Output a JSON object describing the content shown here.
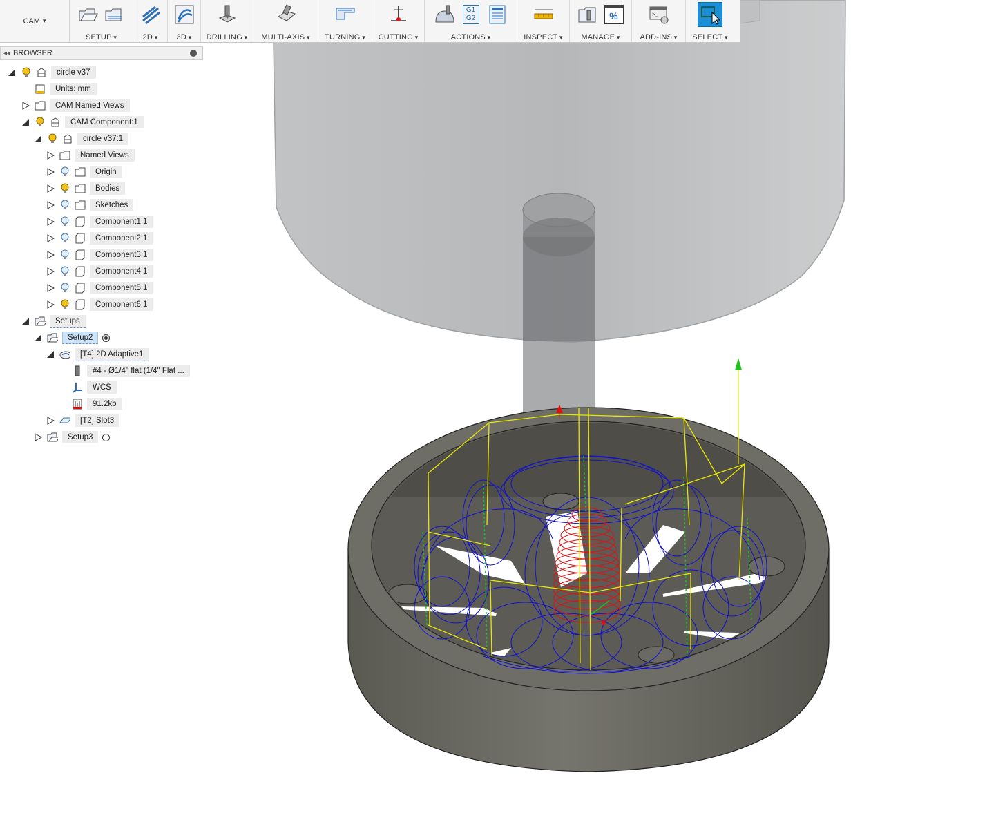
{
  "toolbar": {
    "workspace": "CAM",
    "groups": [
      {
        "label": "SETUP"
      },
      {
        "label": "2D"
      },
      {
        "label": "3D"
      },
      {
        "label": "DRILLING"
      },
      {
        "label": "MULTI-AXIS"
      },
      {
        "label": "TURNING"
      },
      {
        "label": "CUTTING"
      },
      {
        "label": "ACTIONS"
      },
      {
        "label": "INSPECT"
      },
      {
        "label": "MANAGE"
      },
      {
        "label": "ADD-INS"
      },
      {
        "label": "SELECT"
      }
    ],
    "icon_text": {
      "g1g2_top": "G1",
      "g1g2_bottom": "G2",
      "percent": "%"
    },
    "colors": {
      "select_active": "#1a8fd6",
      "accent_blue": "#2c6fb8"
    }
  },
  "browser": {
    "title": "BROWSER",
    "root": "circle v37",
    "units": "Units: mm",
    "cam_named_views": "CAM Named Views",
    "cam_component": "CAM Component:1",
    "component": "circle v37:1",
    "children": [
      "Named Views",
      "Origin",
      "Bodies",
      "Sketches",
      "Component1:1",
      "Component2:1",
      "Component3:1",
      "Component4:1",
      "Component5:1",
      "Component6:1"
    ],
    "setups": "Setups",
    "setup2": "Setup2",
    "operation": "[T4] 2D Adaptive1",
    "tool": "#4 - Ø1/4\" flat (1/4\" Flat ...",
    "wcs": "WCS",
    "filesize": "91.2kb",
    "slot": "[T2] Slot3",
    "setup3": "Setup3"
  },
  "viewport": {
    "colors": {
      "stock": "#9ea1a3",
      "part": "#6f6d66",
      "toolpath_lead": "#f0f000",
      "toolpath_cut": "#1010d0",
      "toolpath_plunge": "#e01010",
      "axis_z": "#20c020"
    }
  }
}
